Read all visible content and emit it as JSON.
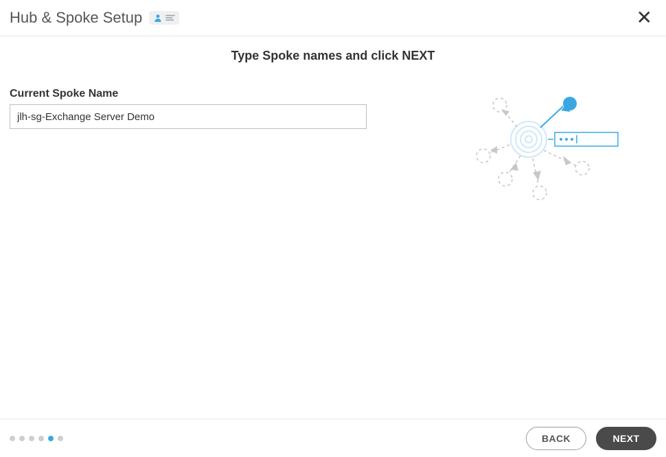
{
  "header": {
    "title": "Hub & Spoke Setup"
  },
  "instruction": "Type Spoke names and click NEXT",
  "form": {
    "current_spoke_label": "Current Spoke Name",
    "current_spoke_value": "jlh-sg-Exchange Server Demo"
  },
  "progress": {
    "total_steps": 6,
    "active_step_index": 4
  },
  "footer": {
    "back_label": "BACK",
    "next_label": "NEXT"
  }
}
